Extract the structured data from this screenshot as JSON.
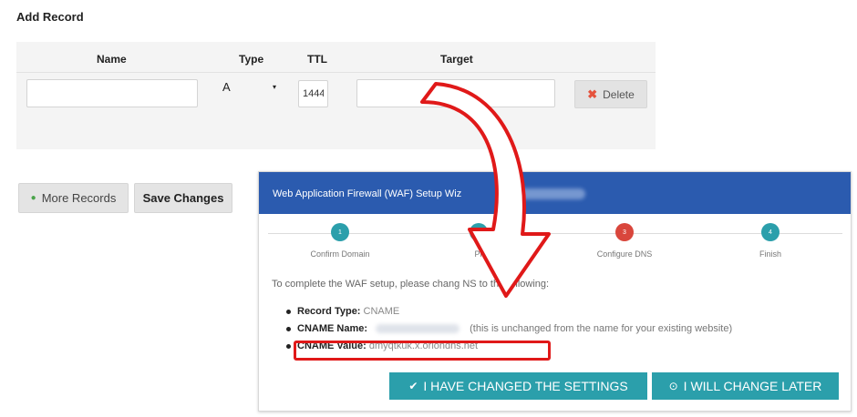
{
  "form": {
    "title": "Add Record",
    "columns": {
      "name": "Name",
      "type": "Type",
      "ttl": "TTL",
      "target": "Target"
    },
    "row": {
      "name_value": "",
      "type_value": "A",
      "type_arrow": "▾",
      "ttl_value": "1444",
      "target_value": "",
      "delete_icon": "✖",
      "delete_label": "Delete"
    },
    "more_icon": "●",
    "more_label": "More Records",
    "save_label": "Save Changes"
  },
  "wizard": {
    "title": "Web Application Firewall (WAF) Setup Wiz",
    "steps": [
      {
        "number": "1",
        "label": "Confirm Domain",
        "color": "#2b9fab"
      },
      {
        "number": "2",
        "label": "Pr",
        "color": "#2b9fab"
      },
      {
        "number": "3",
        "label": "Configure DNS",
        "color": "#d9463c"
      },
      {
        "number": "4",
        "label": "Finish",
        "color": "#2b9fab"
      }
    ],
    "intro": "To complete the WAF setup, please chang                NS to the following:",
    "record_type_label": "Record Type:",
    "record_type_value": "CNAME",
    "cname_name_label": "CNAME Name:",
    "cname_name_note": "(this is unchanged from the name for your existing website)",
    "cname_value_label": "CNAME Value:",
    "cname_value": "dmyqtkuk.x.oriondns.net",
    "changed_icon": "✔",
    "changed_label": "I HAVE CHANGED THE SETTINGS",
    "later_icon": "⊙",
    "later_label": "I WILL CHANGE LATER"
  },
  "colors": {
    "wizard_header": "#2b5baf",
    "accent_teal": "#2b9fab",
    "step_active_red": "#d9463c",
    "highlight_red": "#e01919"
  }
}
